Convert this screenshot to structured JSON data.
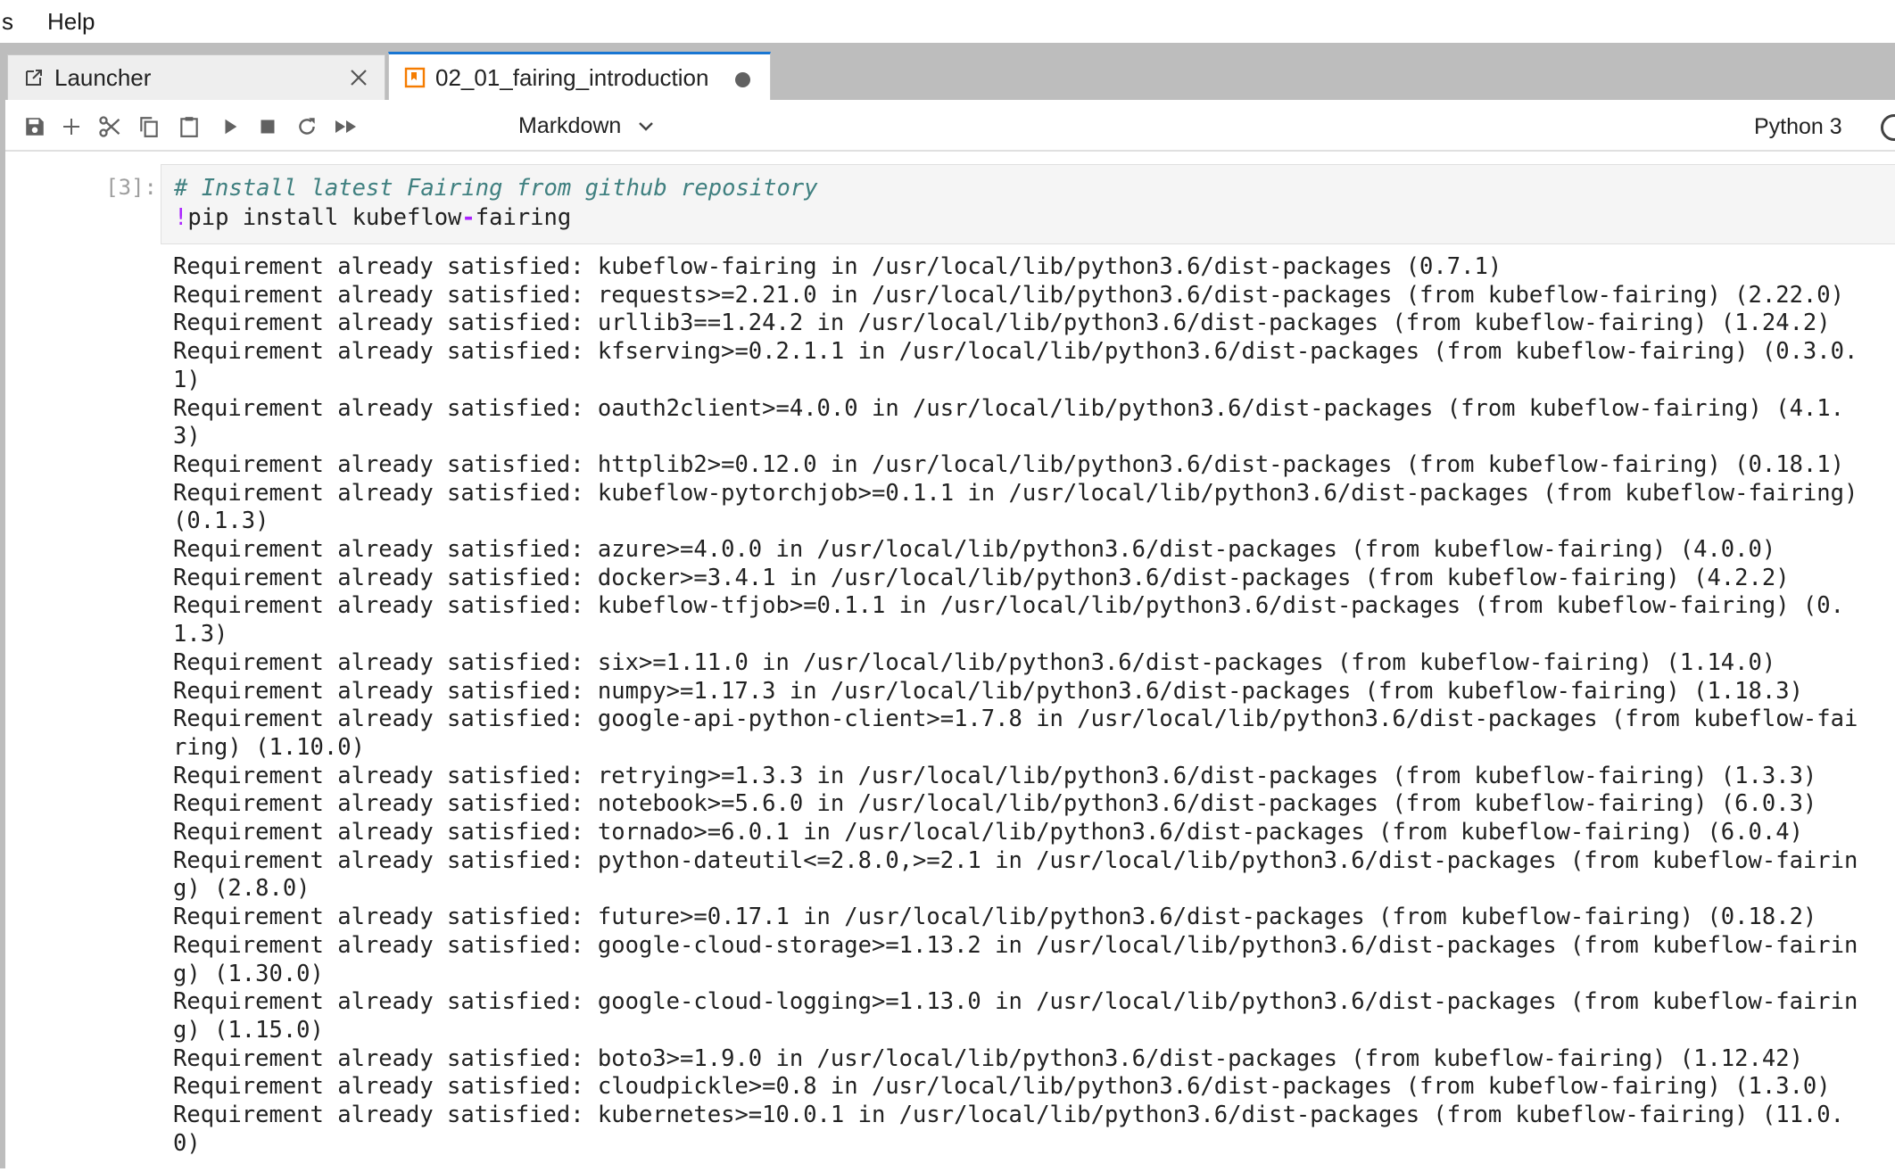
{
  "menubar": {
    "items": [
      "s",
      "Help"
    ]
  },
  "tabs": [
    {
      "label": "Launcher",
      "icon": "launcher-icon",
      "closable": true
    },
    {
      "label": "02_01_fairing_introduction",
      "icon": "notebook-icon",
      "active": true,
      "modified": true
    }
  ],
  "toolbar": {
    "buttons": [
      "save-icon",
      "add-cell-icon",
      "cut-icon",
      "copy-icon",
      "paste-icon",
      "run-icon",
      "stop-icon",
      "restart-icon",
      "run-all-icon"
    ],
    "cell_type": "Markdown",
    "kernel_name": "Python 3"
  },
  "cell": {
    "prompt": "[3]:",
    "comment": "# Install latest Fairing from github repository",
    "bang": "!",
    "cmd_pre": "pip install kubeflow",
    "cmd_op": "-",
    "cmd_post": "fairing",
    "output_lines": [
      "Requirement already satisfied: kubeflow-fairing in /usr/local/lib/python3.6/dist-packages (0.7.1)",
      "Requirement already satisfied: requests>=2.21.0 in /usr/local/lib/python3.6/dist-packages (from kubeflow-fairing) (2.22.0)",
      "Requirement already satisfied: urllib3==1.24.2 in /usr/local/lib/python3.6/dist-packages (from kubeflow-fairing) (1.24.2)",
      "Requirement already satisfied: kfserving>=0.2.1.1 in /usr/local/lib/python3.6/dist-packages (from kubeflow-fairing) (0.3.0.",
      "1)",
      "Requirement already satisfied: oauth2client>=4.0.0 in /usr/local/lib/python3.6/dist-packages (from kubeflow-fairing) (4.1.",
      "3)",
      "Requirement already satisfied: httplib2>=0.12.0 in /usr/local/lib/python3.6/dist-packages (from kubeflow-fairing) (0.18.1)",
      "Requirement already satisfied: kubeflow-pytorchjob>=0.1.1 in /usr/local/lib/python3.6/dist-packages (from kubeflow-fairing)",
      "(0.1.3)",
      "Requirement already satisfied: azure>=4.0.0 in /usr/local/lib/python3.6/dist-packages (from kubeflow-fairing) (4.0.0)",
      "Requirement already satisfied: docker>=3.4.1 in /usr/local/lib/python3.6/dist-packages (from kubeflow-fairing) (4.2.2)",
      "Requirement already satisfied: kubeflow-tfjob>=0.1.1 in /usr/local/lib/python3.6/dist-packages (from kubeflow-fairing) (0.",
      "1.3)",
      "Requirement already satisfied: six>=1.11.0 in /usr/local/lib/python3.6/dist-packages (from kubeflow-fairing) (1.14.0)",
      "Requirement already satisfied: numpy>=1.17.3 in /usr/local/lib/python3.6/dist-packages (from kubeflow-fairing) (1.18.3)",
      "Requirement already satisfied: google-api-python-client>=1.7.8 in /usr/local/lib/python3.6/dist-packages (from kubeflow-fai",
      "ring) (1.10.0)",
      "Requirement already satisfied: retrying>=1.3.3 in /usr/local/lib/python3.6/dist-packages (from kubeflow-fairing) (1.3.3)",
      "Requirement already satisfied: notebook>=5.6.0 in /usr/local/lib/python3.6/dist-packages (from kubeflow-fairing) (6.0.3)",
      "Requirement already satisfied: tornado>=6.0.1 in /usr/local/lib/python3.6/dist-packages (from kubeflow-fairing) (6.0.4)",
      "Requirement already satisfied: python-dateutil<=2.8.0,>=2.1 in /usr/local/lib/python3.6/dist-packages (from kubeflow-fairin",
      "g) (2.8.0)",
      "Requirement already satisfied: future>=0.17.1 in /usr/local/lib/python3.6/dist-packages (from kubeflow-fairing) (0.18.2)",
      "Requirement already satisfied: google-cloud-storage>=1.13.2 in /usr/local/lib/python3.6/dist-packages (from kubeflow-fairin",
      "g) (1.30.0)",
      "Requirement already satisfied: google-cloud-logging>=1.13.0 in /usr/local/lib/python3.6/dist-packages (from kubeflow-fairin",
      "g) (1.15.0)",
      "Requirement already satisfied: boto3>=1.9.0 in /usr/local/lib/python3.6/dist-packages (from kubeflow-fairing) (1.12.42)",
      "Requirement already satisfied: cloudpickle>=0.8 in /usr/local/lib/python3.6/dist-packages (from kubeflow-fairing) (1.3.0)",
      "Requirement already satisfied: kubernetes>=10.0.1 in /usr/local/lib/python3.6/dist-packages (from kubeflow-fairing) (11.0.",
      "0)"
    ]
  },
  "colors": {
    "accent": "#1976d2",
    "tab_bar": "#bdbdbd",
    "notebook_icon": "#f57c00",
    "comment": "#408080",
    "operator": "#aa22ff"
  }
}
